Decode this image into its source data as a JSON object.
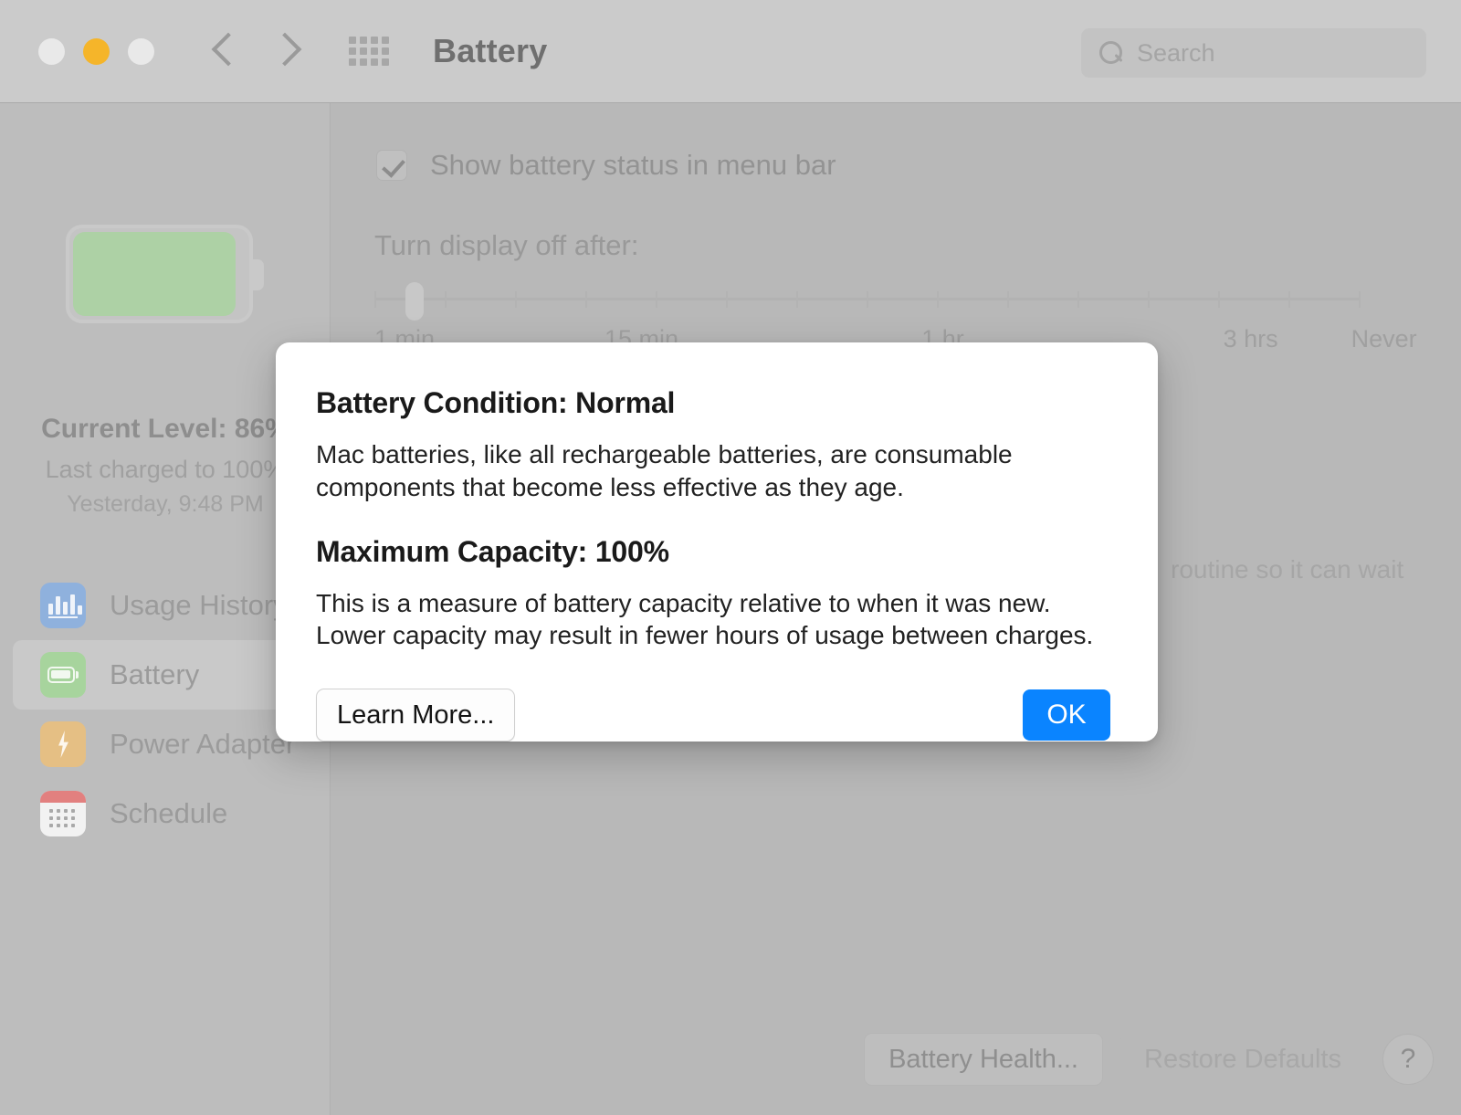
{
  "window": {
    "title": "Battery",
    "traffic_lights": [
      "close",
      "minimize",
      "zoom"
    ],
    "search_placeholder": "Search",
    "search_value": ""
  },
  "sidebar": {
    "battery_level_label": "Current Level: 86%",
    "last_charged_label": "Last charged to 100%",
    "last_charged_time": "Yesterday, 9:48 PM",
    "items": [
      {
        "label": "Usage History",
        "icon": "bar-chart-icon",
        "selected": false,
        "color": "#8fb1dd"
      },
      {
        "label": "Battery",
        "icon": "battery-icon",
        "selected": true,
        "color": "#a7d49d"
      },
      {
        "label": "Power Adapter",
        "icon": "bolt-icon",
        "selected": false,
        "color": "#e5bf84"
      },
      {
        "label": "Schedule",
        "icon": "calendar-icon",
        "selected": false,
        "color": "#e2807f"
      }
    ]
  },
  "main": {
    "menu_bar_checkbox_label": "Show battery status in menu bar",
    "menu_bar_checkbox_checked": true,
    "display_off_label": "Turn display off after:",
    "slider": {
      "value_label": "1 min",
      "tick_labels": [
        "1 min",
        "15 min",
        "1 hr",
        "3 hrs",
        "Never"
      ],
      "tick_positions_pct": [
        0,
        22.5,
        53.5,
        83,
        95.5
      ],
      "thumb_position_pct": 3.2,
      "tick_count": 14
    },
    "partial_text": "routine so it can wait",
    "buttons": {
      "battery_health": "Battery Health...",
      "restore_defaults": "Restore Defaults",
      "help": "?"
    }
  },
  "dialog": {
    "condition_heading": "Battery Condition: Normal",
    "condition_body": "Mac batteries, like all rechargeable batteries, are consumable components that become less effective as they age.",
    "capacity_heading": "Maximum Capacity: 100%",
    "capacity_body": "This is a measure of battery capacity relative to when it was new. Lower capacity may result in fewer hours of usage between charges.",
    "learn_more_label": "Learn More...",
    "ok_label": "OK",
    "accent_color": "#0a84ff"
  }
}
